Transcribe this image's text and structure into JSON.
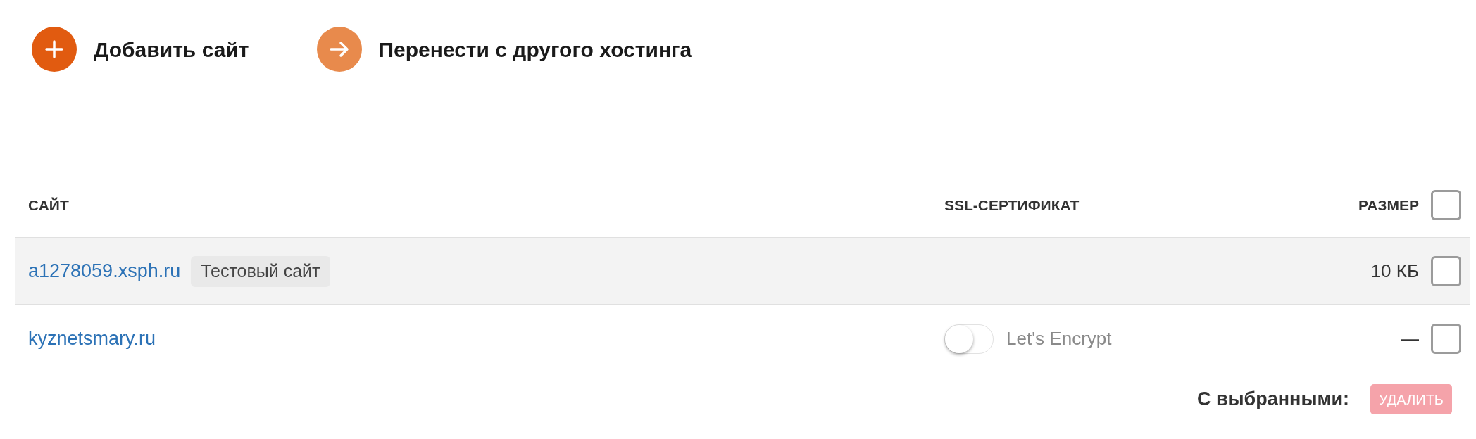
{
  "actions": [
    {
      "kind": "add",
      "label": "Добавить сайт"
    },
    {
      "kind": "transfer",
      "label": "Перенести с другого хостинга"
    }
  ],
  "table": {
    "columns": [
      "САЙТ",
      "SSL-СЕРТИФИКАТ",
      "РАЗМЕР"
    ],
    "select_all": {
      "checked": false
    },
    "rows": [
      {
        "site": "a1278059.xsph.ru",
        "tag": "Тестовый сайт",
        "size": "10 КБ",
        "checked": false,
        "hovered": true
      },
      {
        "site": "kyznetsmary.ru",
        "ssl": {
          "label": "Let's Encrypt",
          "on": false
        },
        "size": "—",
        "checked": false,
        "hovered": false
      }
    ]
  },
  "bulk_actions": {
    "label": "С выбранными:",
    "button": {
      "label": "УДАЛИТЬ",
      "disabled": true
    }
  }
}
